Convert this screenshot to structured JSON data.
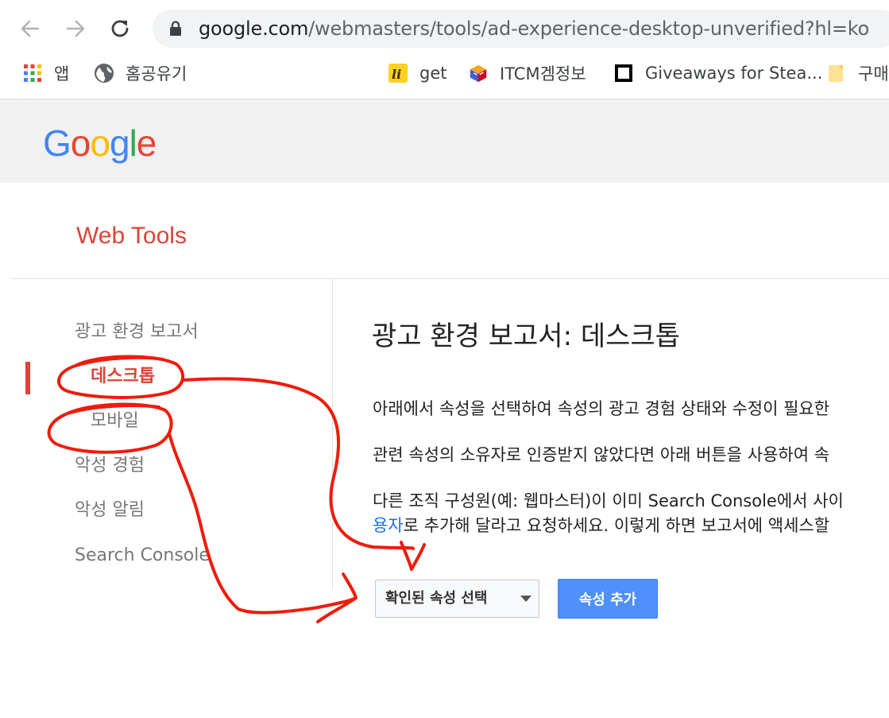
{
  "browser": {
    "url_host": "google.com",
    "url_path": "/webmasters/tools/ad-experience-desktop-unverified?hl=ko",
    "bookmarks": [
      {
        "label": "앱",
        "icon": "apps-grid-icon"
      },
      {
        "label": "홈공유기",
        "icon": "globe-icon"
      },
      {
        "label": "get",
        "icon": "li-app-icon"
      },
      {
        "label": "ITCM겜정보",
        "icon": "box-app-icon"
      },
      {
        "label": "Giveaways for Stea...",
        "icon": "square-logo-icon"
      },
      {
        "label": "구매",
        "icon": "folder-icon"
      }
    ]
  },
  "page": {
    "logo": "Google",
    "brand_title": "Web Tools",
    "sidebar": {
      "items": [
        {
          "label": "광고 환경 보고서"
        },
        {
          "label": "데스크톱"
        },
        {
          "label": "모바일"
        },
        {
          "label": "악성 경험"
        },
        {
          "label": "악성 알림"
        },
        {
          "label": "Search Console"
        }
      ]
    },
    "heading": "광고 환경 보고서: 데스크톱",
    "paragraphs": {
      "p1": "아래에서 속성을 선택하여 속성의 광고 경험 상태와 수정이 필요한",
      "p2": "관련 속성의 소유자로 인증받지 않았다면 아래 버튼을 사용하여 속",
      "p3_line1": "다른 조직 구성원(예: 웹마스터)이 이미 Search Console에서 사이",
      "p3_link": "용자",
      "p3_line2": "로 추가해 달라고 요청하세요. 이렇게 하면 보고서에 액세스할"
    },
    "property_select": {
      "value": "확인된 속성 선택"
    },
    "add_property_button": "속성 추가"
  },
  "colors": {
    "brand_red": "#db4437",
    "button_blue": "#4d90fe",
    "annotation_red": "#ee1c0c",
    "link_blue": "#1a73e8"
  }
}
